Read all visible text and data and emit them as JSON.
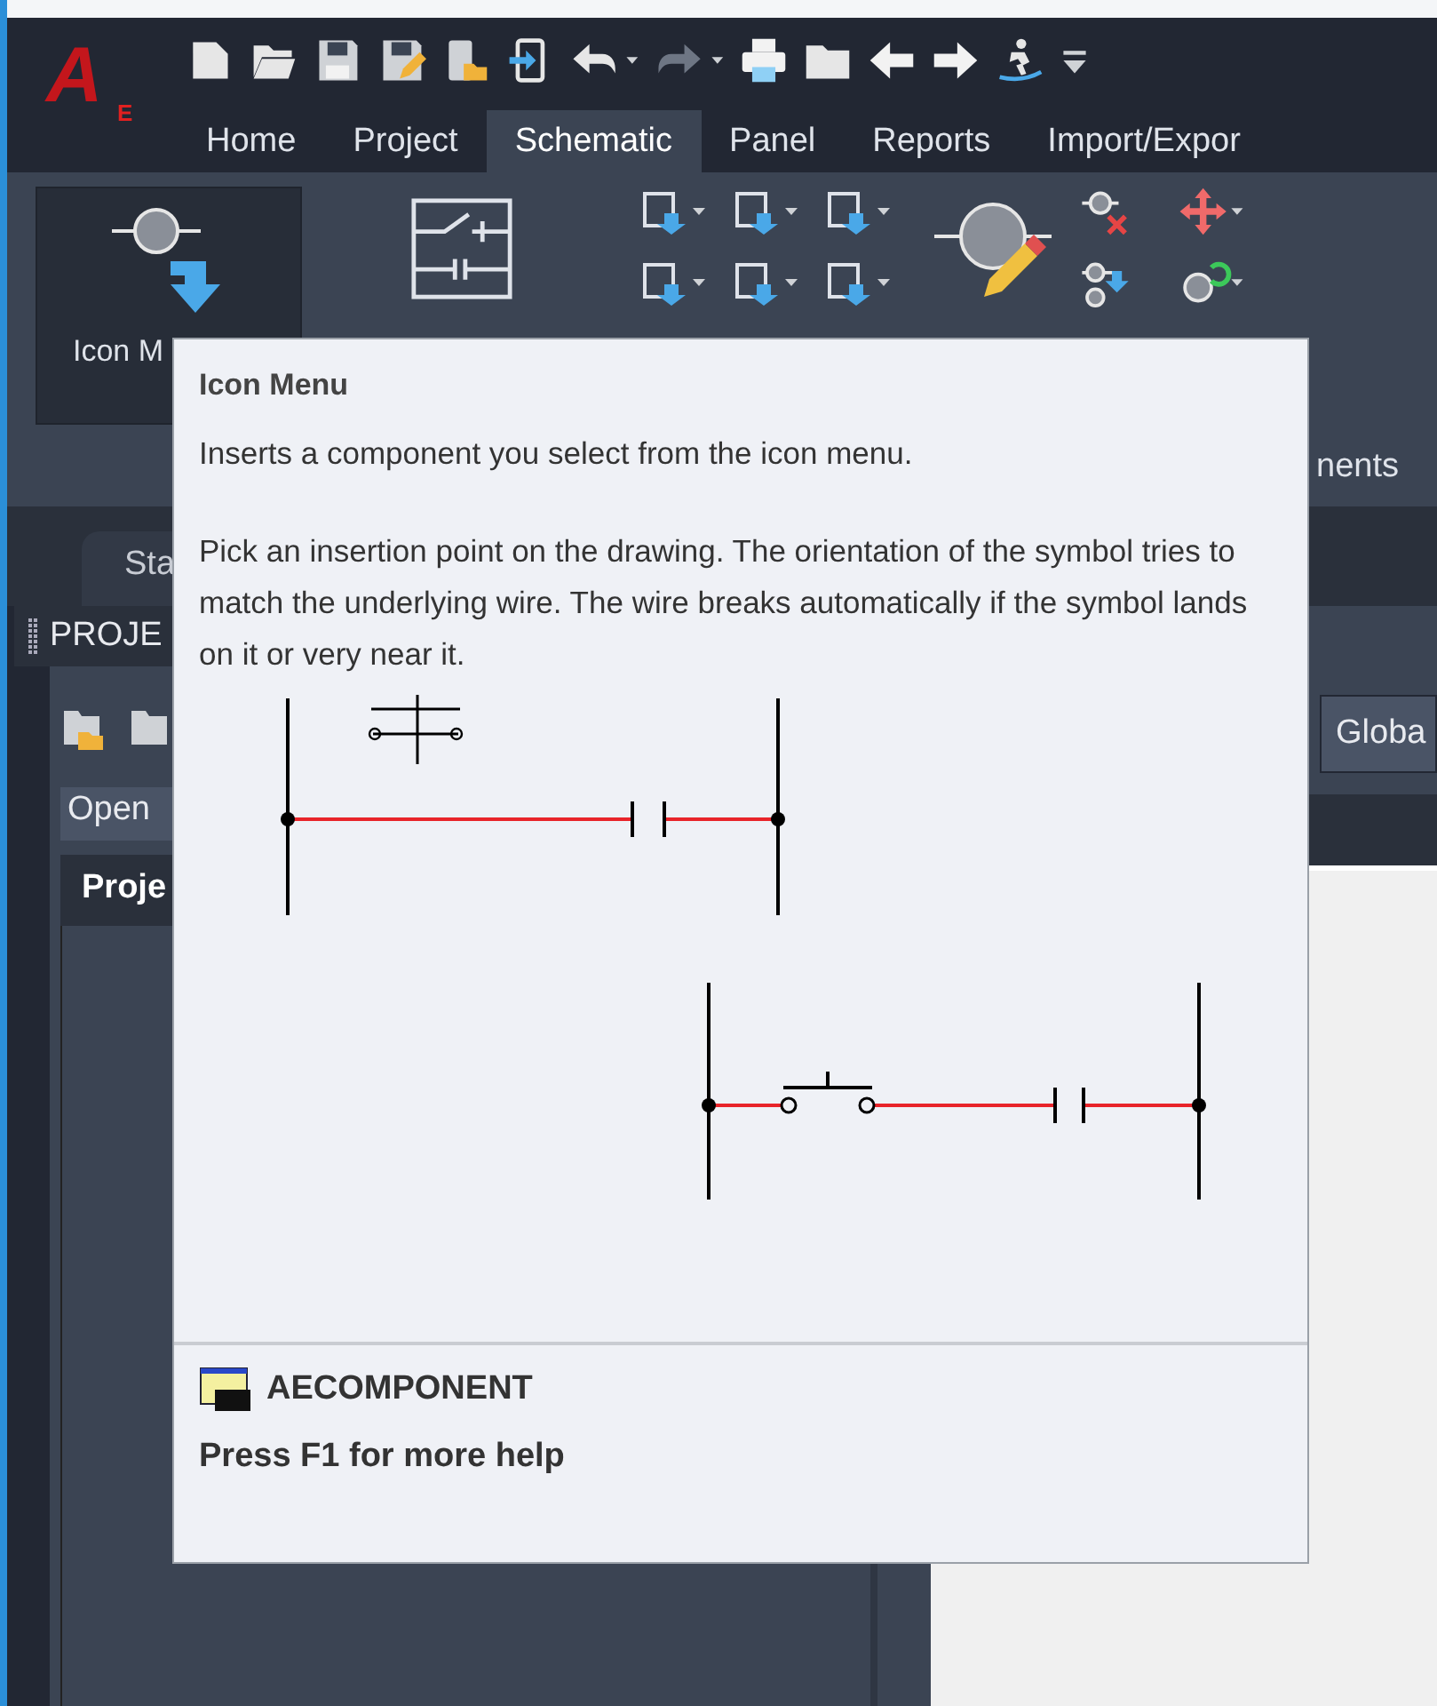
{
  "app_logo": {
    "letter": "A",
    "subscript": "E"
  },
  "ribbon_tabs": [
    {
      "label": "Home",
      "selected": false
    },
    {
      "label": "Project",
      "selected": false
    },
    {
      "label": "Schematic",
      "selected": true
    },
    {
      "label": "Panel",
      "selected": false
    },
    {
      "label": "Reports",
      "selected": false
    },
    {
      "label": "Import/Expor",
      "selected": false
    }
  ],
  "ribbon": {
    "icon_menu_button": {
      "label": "Icon M"
    },
    "panel_label": "nents"
  },
  "document_tabs": [
    {
      "label": "Sta"
    }
  ],
  "project_manager": {
    "title": "PROJE",
    "dropdown": {
      "value": "Open"
    },
    "tree_header": "Proje"
  },
  "right_panel": {
    "button": "Globa"
  },
  "tooltip": {
    "title": "Icon Menu",
    "description": "Inserts a component you select from the icon menu.",
    "details": "Pick an insertion point on the drawing. The orientation of the symbol tries to match the underlying wire. The wire breaks automatically if the symbol lands on it or very near it.",
    "command": "AECOMPONENT",
    "help_hint": "Press F1 for more help"
  }
}
